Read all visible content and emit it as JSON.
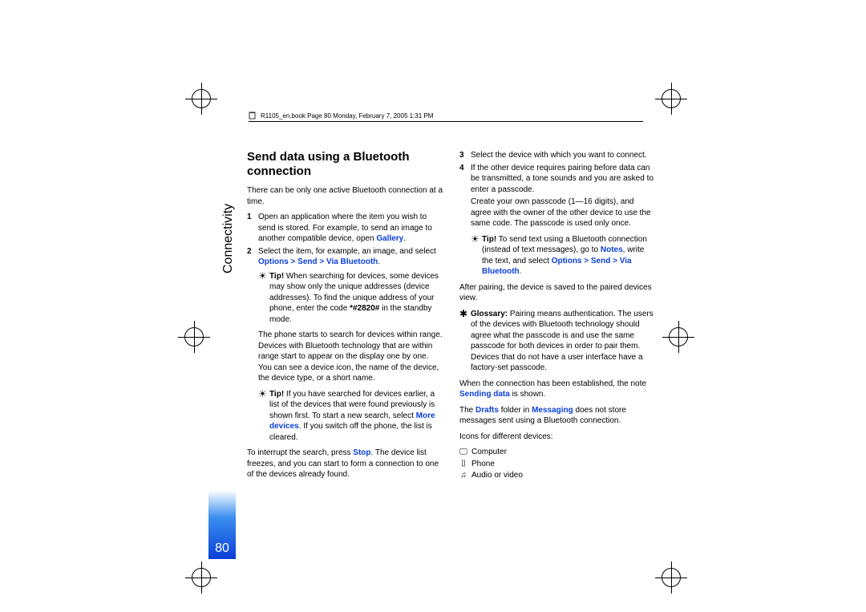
{
  "header": {
    "text": "R1105_en.book  Page 80  Monday, February 7, 2005  1:31 PM"
  },
  "sidebar": {
    "section": "Connectivity",
    "page_number": "80"
  },
  "title": "Send data using a Bluetooth connection",
  "intro": "There can be only one active Bluetooth connection at a time.",
  "step1_a": "Open an application where the item you wish to send is stored. For example, to send an image to another compatible device, open ",
  "gallery": "Gallery",
  "step2_a": "Select the item, for example, an image, and select ",
  "options_send": "Options > Send > Via Bluetooth",
  "tip1_bold": "Tip!",
  "tip1": " When searching for devices, some devices may show only the unique addresses (device addresses). To find the unique address of your phone, enter the code ",
  "tip1_code": "*#2820#",
  "tip1_end": " in the standby mode.",
  "para_search": "The phone starts to search for devices within range. Devices with Bluetooth technology that are within range start to appear on the display one by one. You can see a device icon, the name of the device, the device type, or a short name.",
  "tip2_bold": "Tip!",
  "tip2_a": " If you have searched for devices earlier, a list of the devices that were found previously is shown first. To start a new search, select ",
  "more_devices": "More devices",
  "tip2_b": ". If you switch off the phone, the list is cleared.",
  "para_stop_a": "To interrupt the search, press ",
  "stop": "Stop",
  "para_stop_b": ". The device list freezes, and you can start to form a connection to one of the devices already found.",
  "step3": "Select the device with which you want to connect.",
  "step4": "If the other device requires pairing before data can be transmitted, a tone sounds and you are asked to enter a passcode.",
  "step4_b": "Create your own passcode (1—16 digits), and agree with the owner of the other device to use the same code. The passcode is used only once.",
  "tip3_bold": "Tip!",
  "tip3_a": " To send text using a Bluetooth connection (instead of text messages), go to ",
  "notes": "Notes",
  "tip3_b": ", write the text, and select ",
  "para_after": "After pairing, the device is saved to the paired devices view.",
  "gloss_bold": "Glossary:",
  "gloss": " Pairing means authentication. The users of the devices with Bluetooth technology should agree what the passcode is and use the same passcode for both devices in order to pair them. Devices that do not have a user interface have a factory-set passcode.",
  "para_conn_a": "When the connection has been established, the note ",
  "sending_data": "Sending data",
  "para_conn_b": " is shown.",
  "para_drafts_a": "The ",
  "drafts": "Drafts",
  "para_drafts_b": " folder in ",
  "messaging": "Messaging",
  "para_drafts_c": " does not store messages sent using a Bluetooth connection.",
  "icons_title": "Icons for different devices:",
  "icon1": "Computer",
  "icon2": "Phone",
  "icon3": "Audio or video",
  "period": "."
}
